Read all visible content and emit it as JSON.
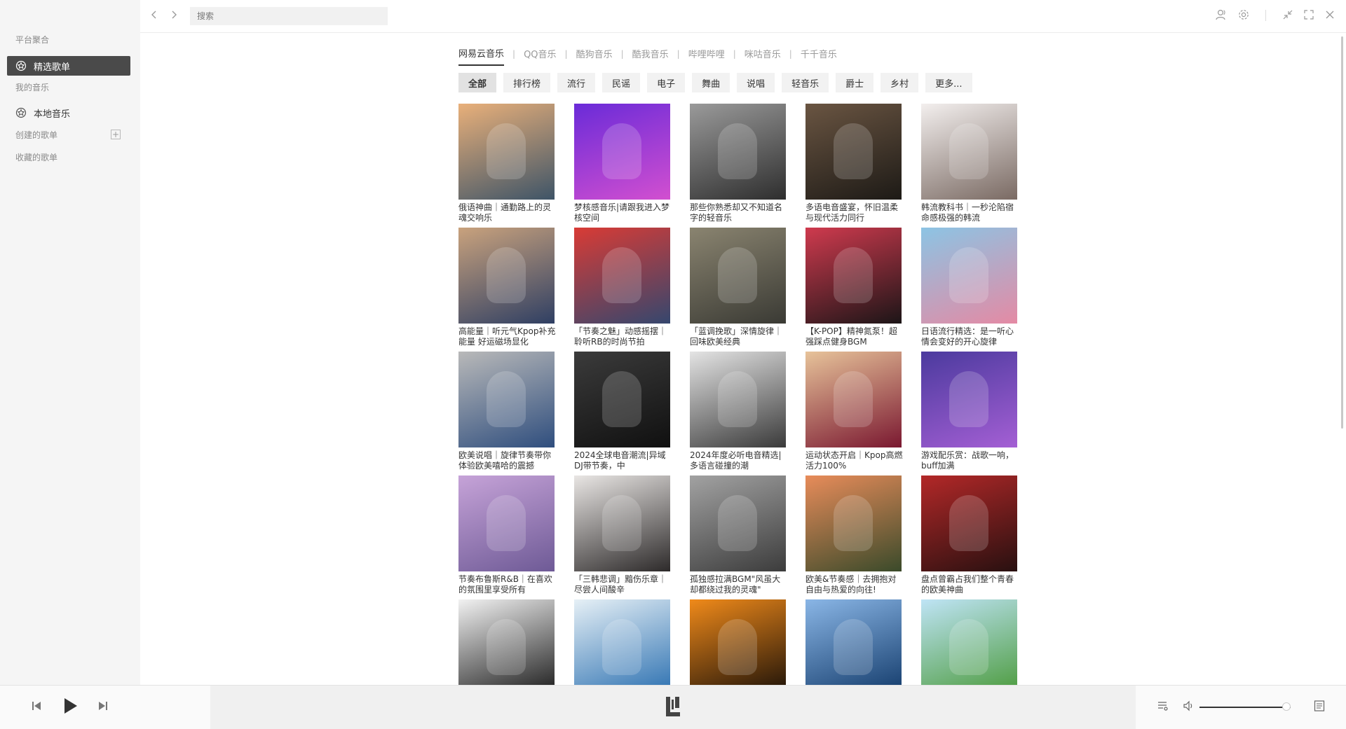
{
  "sidebar": {
    "group_platform": "平台聚合",
    "item_featured": "精选歌单",
    "group_my_music": "我的音乐",
    "item_local": "本地音乐",
    "group_created": "创建的歌单",
    "group_favorites": "收藏的歌单"
  },
  "topbar": {
    "search_placeholder": "搜索",
    "icons": [
      "back-icon",
      "forward-icon",
      "user-icon",
      "settings-icon",
      "minimize-icon",
      "fullscreen-icon",
      "close-icon"
    ]
  },
  "platforms": [
    "网易云音乐",
    "QQ音乐",
    "酷狗音乐",
    "酷我音乐",
    "哔哩哔哩",
    "咪咕音乐",
    "千千音乐"
  ],
  "active_platform": "网易云音乐",
  "categories": [
    "全部",
    "排行榜",
    "流行",
    "民谣",
    "电子",
    "舞曲",
    "说唱",
    "轻音乐",
    "爵士",
    "乡村",
    "更多..."
  ],
  "active_category": "全部",
  "playlists": [
    {
      "title": "俄语神曲｜通勤路上的灵魂交响乐",
      "colors": [
        "#e9b07a",
        "#3e5467"
      ]
    },
    {
      "title": "梦核感音乐|请跟我进入梦核空间",
      "colors": [
        "#6a2bd8",
        "#d24fd0"
      ]
    },
    {
      "title": "那些你熟悉却又不知道名字的轻音乐",
      "colors": [
        "#9a9a9a",
        "#2e2e2e"
      ]
    },
    {
      "title": "多语电音盛宴，怀旧温柔与现代活力同行",
      "colors": [
        "#6a5542",
        "#1d1a16"
      ]
    },
    {
      "title": "韩流教科书｜一秒沦陷宿命感极强的韩流",
      "colors": [
        "#f3efee",
        "#7a6a63"
      ]
    },
    {
      "title": "高能量｜听元气Kpop补充能量 好运磁场显化",
      "colors": [
        "#c9a27d",
        "#2f3f63"
      ]
    },
    {
      "title": "「节奏之魅」动感摇摆｜聆听RB的时尚节拍",
      "colors": [
        "#d93b35",
        "#35476e"
      ]
    },
    {
      "title": "「蓝调挽歌」深情旋律｜回味欧美经典",
      "colors": [
        "#8a8470",
        "#3a3a34"
      ]
    },
    {
      "title": "【K-POP】精神氮泵！超强踩点健身BGM",
      "colors": [
        "#cf3a4e",
        "#1c1517"
      ]
    },
    {
      "title": "日语流行精选：是一听心情会变好的开心旋律",
      "colors": [
        "#8cc4e4",
        "#e48aa4"
      ]
    },
    {
      "title": "欧美说唱｜旋律节奏带你体验欧美嘻哈的震撼",
      "colors": [
        "#b9b9b9",
        "#2f4e7e"
      ]
    },
    {
      "title": "2024全球电音潮流|异域DJ带节奏，中",
      "colors": [
        "#3b3b3b",
        "#101010"
      ]
    },
    {
      "title": "2024年度必听电音精选|多语言碰撞的潮",
      "colors": [
        "#e4e4e4",
        "#3a3a3a"
      ]
    },
    {
      "title": "运动状态开启｜Kpop高燃活力100%",
      "colors": [
        "#e7c39a",
        "#7a1830"
      ]
    },
    {
      "title": "游戏配乐赏：战歌一响，buff加满",
      "colors": [
        "#4b3a9e",
        "#a45fd4"
      ]
    },
    {
      "title": "节奏布鲁斯R&B｜在喜欢的氛围里享受所有",
      "colors": [
        "#c6a3d8",
        "#6e5a96"
      ]
    },
    {
      "title": "「三韩悲调」黯伤乐章｜尽尝人间酸辛",
      "colors": [
        "#e9e6e4",
        "#2d2a2a"
      ]
    },
    {
      "title": "孤独感拉满BGM\"风虽大却都绕过我的灵魂\"",
      "colors": [
        "#a2a2a2",
        "#3c3c3c"
      ]
    },
    {
      "title": "欧美&节奏感｜去拥抱对自由与热爱的向往!",
      "colors": [
        "#e88c5a",
        "#3a4a2a"
      ]
    },
    {
      "title": "盘点曾霸占我们整个青春的欧美神曲",
      "colors": [
        "#b32828",
        "#281010"
      ]
    },
    {
      "title": "",
      "colors": [
        "#f2f2f2",
        "#1a1a1a"
      ]
    },
    {
      "title": "",
      "colors": [
        "#e6f0f6",
        "#2a6fb0"
      ]
    },
    {
      "title": "",
      "colors": [
        "#f08a1a",
        "#1a1008"
      ]
    },
    {
      "title": "",
      "colors": [
        "#8ab6e6",
        "#123a6a"
      ]
    },
    {
      "title": "",
      "colors": [
        "#bfe4f6",
        "#4a9a3a"
      ]
    }
  ],
  "player": {
    "volume": 0.95,
    "icons": [
      "prev-icon",
      "play-icon",
      "next-icon",
      "app-logo",
      "playlist-icon",
      "volume-icon",
      "lyrics-icon"
    ]
  }
}
